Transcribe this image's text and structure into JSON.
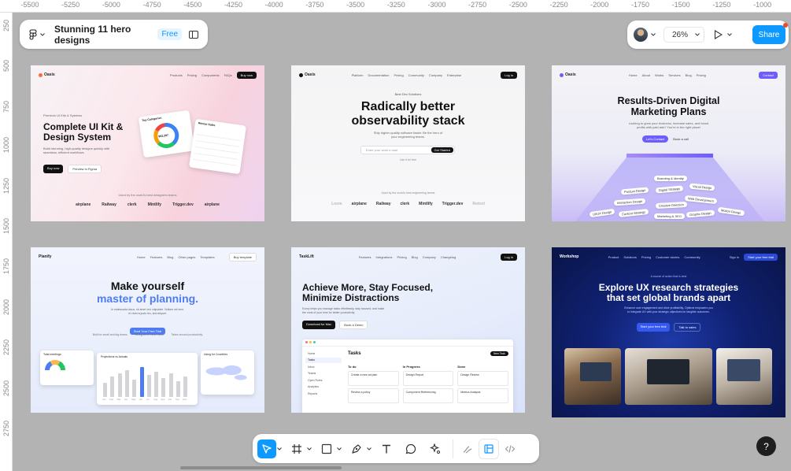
{
  "ruler": {
    "top_labels": [
      "-5500",
      "-5250",
      "-5000",
      "-4750",
      "-4500",
      "-4250",
      "-4000",
      "-3750",
      "-3500",
      "-3250",
      "-3000",
      "-2750",
      "-2500",
      "-2250",
      "-2000",
      "-1750",
      "-1500",
      "-1250",
      "-1000"
    ],
    "left_labels": [
      "250",
      "500",
      "750",
      "1000",
      "1250",
      "1500",
      "1750",
      "2000",
      "2250",
      "2500",
      "2750"
    ]
  },
  "file": {
    "name": "Stunning 11 hero designs",
    "plan": "Free",
    "menu_icon": "figma-logo-icon",
    "panel_icon": "sidebar-panel-icon"
  },
  "header": {
    "zoom": "26%",
    "share_label": "Share"
  },
  "cards": {
    "c1": {
      "brand": "Oasis",
      "nav": [
        "Products",
        "Pricing",
        "Components",
        "FAQs"
      ],
      "cta": "Buy now",
      "eyebrow": "Premium UI Kits & Systems",
      "title1": "Complete UI Kit &",
      "title2": "Design System",
      "sub1": "Build stunning, high-quality designs quickly with",
      "sub2": "seamless, efficient workflows.",
      "btn1": "Buy now",
      "btn2": "Preview in Figma",
      "trusted": "Used by the world's best designers teams",
      "logos": [
        "airplane",
        "Railway",
        "clerk",
        "Mintlify",
        "Trigger.dev",
        "airplane"
      ],
      "widget1_title": "Top Categories",
      "widget1_value": "$53,297",
      "widget2_title": "Recent Sales"
    },
    "c2": {
      "brand": "Oasis",
      "nav": [
        "Platform",
        "Documentation",
        "Pricing",
        "Community",
        "Company",
        "Enterprise"
      ],
      "cta": "Log in",
      "eyebrow": "Best Dev Solutions",
      "title1": "Radically better",
      "title2": "observability stack",
      "sub1": "Ship higher-quality software faster. Be the hero of",
      "sub2": "your engineering teams.",
      "input_placeholder": "Enter your work e-mail",
      "btn": "Get Started",
      "note": "Use it for free",
      "trusted": "Used by the world's best engineering teams",
      "logos": [
        "Loom",
        "airplane",
        "Railway",
        "clerk",
        "Mintlify",
        "Trigger.dev",
        "Retool"
      ]
    },
    "c3": {
      "brand": "Oasis",
      "nav": [
        "Home",
        "About",
        "Works",
        "Services",
        "Blog",
        "Pricing"
      ],
      "cta": "Contact",
      "title1": "Results-Driven Digital",
      "title2": "Marketing Plans",
      "sub1": "Looking to grow your business, increase sales, and boost",
      "sub2": "profits with paid ads? You're in the right place!",
      "btn1": "Let's Contact",
      "btn2": "Book a call",
      "tags": [
        "Branding & Identity",
        "Product Design",
        "Digital Strategy",
        "Visual Design",
        "Interaction Design",
        "Web Development",
        "Creative Direction",
        "UI/UX Design",
        "Content Strategy",
        "Marketing & SEO",
        "Graphic Design",
        "Motion Design"
      ]
    },
    "c4": {
      "brand": "Planify",
      "nav": [
        "Home",
        "Features",
        "Blog",
        "Other pages",
        "Templates"
      ],
      "cta": "Buy template",
      "title1": "Make yourself",
      "title2": "master of planning.",
      "sub1": "In malesuada lacus, sit amet orci vulputate. Nullam vel sem,",
      "sub2": "et viverra justo leo, and aliquet.",
      "btn": "Start Your Free Trial",
      "features": [
        "Built for small and big teams",
        "Designed in New Hand",
        "Takes around productivity"
      ],
      "w1": "Total meetings",
      "w2": "Projections vs Actuals",
      "w3": "Using for Countries",
      "months": [
        "Jan",
        "Feb",
        "Mar",
        "Apr",
        "May",
        "Jun",
        "Jul",
        "Aug",
        "Sep",
        "Oct",
        "Nov",
        "Dec"
      ]
    },
    "c5": {
      "brand": "TaskLift",
      "nav": [
        "Features",
        "Integrations",
        "Pricing",
        "Blog",
        "Company",
        "Changelog"
      ],
      "cta": "Log in",
      "title1": "Achieve More, Stay Focused,",
      "title2": "Minimize Distractions",
      "sub1": "Ezzzy helps you manage tasks effortlessly, stay focused, and make",
      "sub2": "the most of your time for better productivity.",
      "btn1": "Download for Mac",
      "btn2": "Book a Demo",
      "app_title": "Tasks",
      "new_task": "New Task",
      "sidebar": [
        "Home",
        "Tasks",
        "Inbox",
        "Teams",
        "Open Roles",
        "Analytics",
        "Reports"
      ],
      "columns": [
        {
          "name": "To do",
          "cards": [
            "Create a new ad plan",
            "Review a policy"
          ]
        },
        {
          "name": "In Progress",
          "cards": [
            "Design Report",
            "Component Referencing"
          ]
        },
        {
          "name": "Done",
          "cards": [
            "Design Review",
            "Metrics Analysis"
          ]
        }
      ]
    },
    "c6": {
      "brand": "Workshop",
      "nav": [
        "Product",
        "Solutions",
        "Pricing",
        "Customer stories",
        "Community"
      ],
      "signin": "Sign in",
      "cta": "Start your free trial",
      "eyebrow": "A course of action that is best",
      "title1": "Explore UX research strategies",
      "title2": "that set global brands apart",
      "sub1": "Enhance user engagement and drive profitability. Optimal empowers you",
      "sub2": "to integrate UX with your strategic objectives for tangible outcomes.",
      "btn1": "Start your free trial",
      "btn2": "Talk to sales"
    }
  },
  "toolbar": {
    "tools": [
      "Move",
      "Frame",
      "Shape",
      "Pen",
      "Text",
      "Comment",
      "Actions",
      "Draw",
      "Design",
      "Dev Mode"
    ]
  },
  "help": "?"
}
